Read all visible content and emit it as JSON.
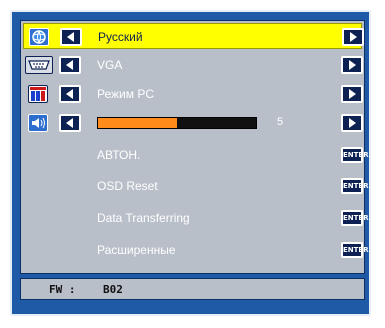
{
  "menu": {
    "rows": [
      {
        "label": "Русский",
        "icon": "globe-icon",
        "control": "arrows"
      },
      {
        "label": "VGA",
        "icon": "vga-connector-icon",
        "control": "arrows"
      },
      {
        "label": "Режим PC",
        "icon": "display-mode-icon",
        "control": "arrows"
      },
      {
        "label": "",
        "icon": "speaker-icon",
        "control": "slider",
        "value": "5",
        "fill_fraction": 0.5
      },
      {
        "label": "АВТОН.",
        "control": "enter"
      },
      {
        "label": "OSD Reset",
        "control": "enter"
      },
      {
        "label": "Data Transferring",
        "control": "enter"
      },
      {
        "label": "Расширенные",
        "control": "enter"
      }
    ],
    "enter_label": "ENTER"
  },
  "footer": {
    "fw_label": "FW :",
    "fw_value": "B02"
  },
  "colors": {
    "background": "#1f5aa6",
    "panel": "#b9bfc9",
    "selected": "#ffff00",
    "button": "#0d2252",
    "slider_fill": "#ff8c1a"
  }
}
